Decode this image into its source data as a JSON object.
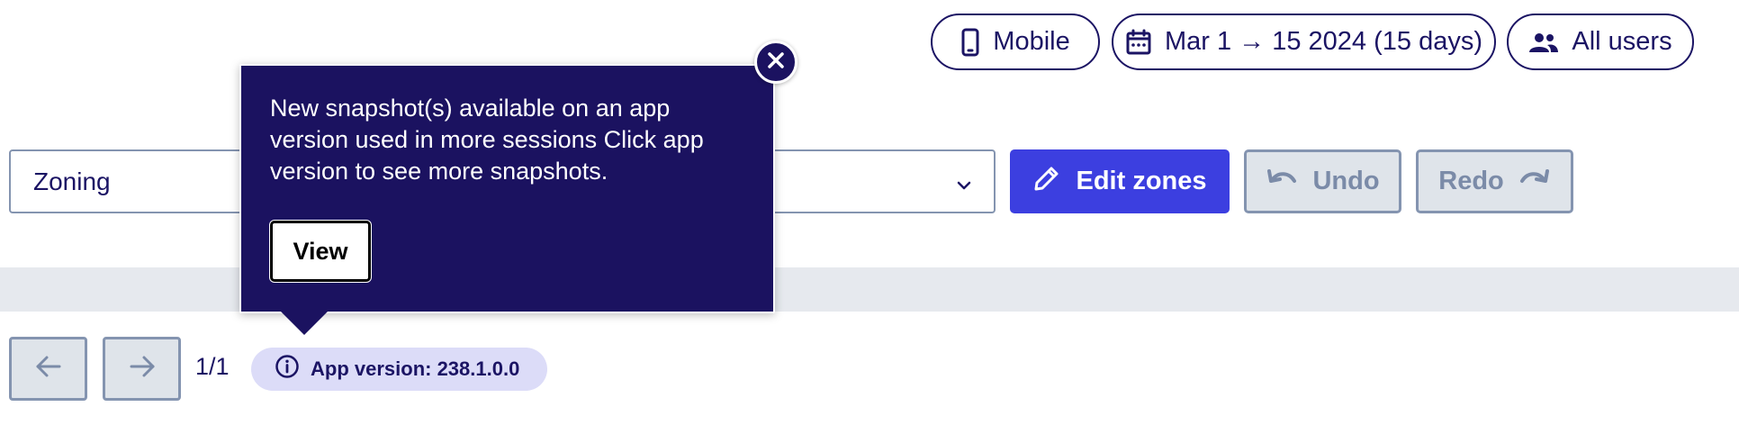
{
  "filters": {
    "device": {
      "label": "Mobile",
      "icon": "mobile-phone-icon"
    },
    "date_range": {
      "label": "Mar 1 → 15 2024 (15 days)",
      "icon": "calendar-icon"
    },
    "audience": {
      "label": "All users",
      "icon": "users-icon"
    }
  },
  "toolbar": {
    "select_value": "Zoning",
    "edit_label": "Edit zones",
    "undo_label": "Undo",
    "redo_label": "Redo"
  },
  "pagination": {
    "page_label": "1/1",
    "app_version_label": "App version: 238.1.0.0"
  },
  "tooltip": {
    "message": "New snapshot(s) available on an app version used in more sessions Click app version to see more snapshots.",
    "view_label": "View"
  },
  "colors": {
    "navy": "#1b1464",
    "tooltip_bg": "#1b1260",
    "accent": "#3c3fe0",
    "disabled_bg": "#dfe4ea",
    "version_pill_bg": "#dcdcf8"
  }
}
